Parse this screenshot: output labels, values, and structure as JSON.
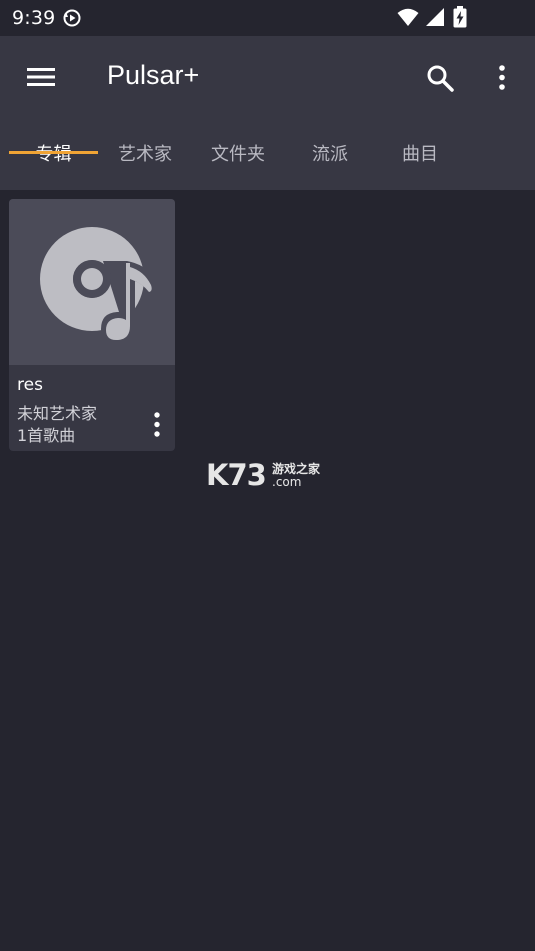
{
  "status_bar": {
    "time": "9:39"
  },
  "app_bar": {
    "title": "Pulsar+"
  },
  "tabs": [
    {
      "label": "专辑",
      "active": true
    },
    {
      "label": "艺术家",
      "active": false
    },
    {
      "label": "文件夹",
      "active": false
    },
    {
      "label": "流派",
      "active": false
    },
    {
      "label": "曲目",
      "active": false
    }
  ],
  "albums": [
    {
      "name": "res",
      "artist": "未知艺术家",
      "song_count": "1首歌曲"
    }
  ],
  "watermark": {
    "logo": "K73",
    "cn_text": "游戏之家",
    "domain": ".com"
  },
  "colors": {
    "background": "#25252f",
    "app_bar": "#373743",
    "accent": "#f0a435",
    "card": "#373743",
    "album_art_bg": "#4b4b58",
    "placeholder_icon": "#bdbdc3"
  },
  "icons": {
    "status_left": "media-sync-icon",
    "wifi": "wifi-icon",
    "signal": "signal-icon",
    "battery": "battery-charging-icon",
    "menu": "hamburger-menu-icon",
    "search": "search-icon",
    "more": "more-vert-icon",
    "album_placeholder": "disc-music-note-icon"
  }
}
